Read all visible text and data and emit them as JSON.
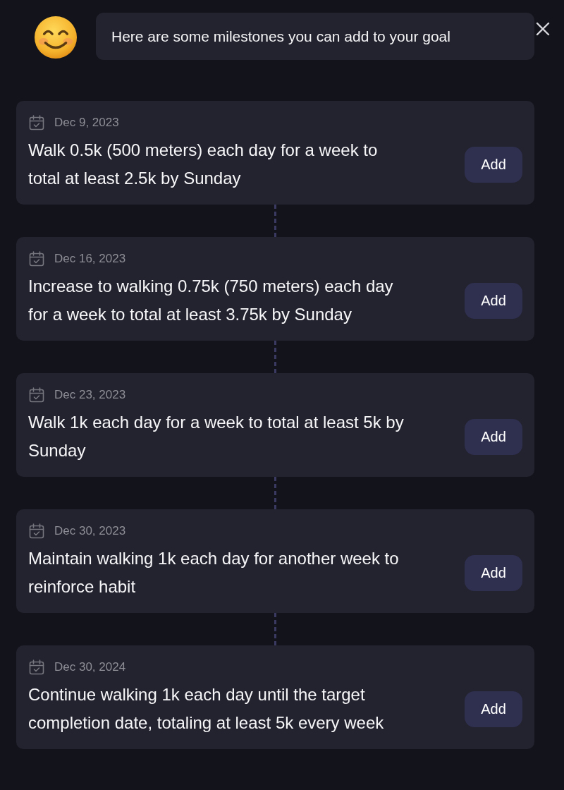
{
  "message": {
    "text": "Here are some milestones you can add to your goal"
  },
  "milestones": [
    {
      "date": "Dec 9, 2023",
      "text": "Walk 0.5k (500 meters) each day for a week to total at least 2.5k by Sunday",
      "action": "Add"
    },
    {
      "date": "Dec 16, 2023",
      "text": "Increase to walking 0.75k (750 meters) each day for a week to total at least 3.75k by Sunday",
      "action": "Add"
    },
    {
      "date": "Dec 23, 2023",
      "text": "Walk 1k each day for a week to total at least 5k by Sunday",
      "action": "Add"
    },
    {
      "date": "Dec 30, 2023",
      "text": "Maintain walking 1k each day for another week to reinforce habit",
      "action": "Add"
    },
    {
      "date": "Dec 30, 2024",
      "text": "Continue walking 1k each day until the target completion date, totaling at least 5k every week",
      "action": "Add"
    }
  ]
}
